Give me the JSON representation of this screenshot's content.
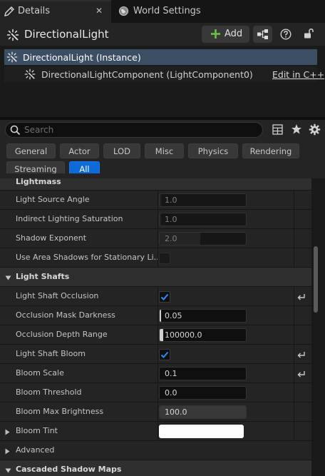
{
  "tabs": {
    "details": "Details",
    "close": "✕",
    "world_settings": "World Settings"
  },
  "header": {
    "title": "DirectionalLight",
    "add_label": "Add"
  },
  "tree": {
    "instance": "DirectionalLight (Instance)",
    "component": "DirectionalLightComponent (LightComponent0)",
    "edit_link": "Edit in C++"
  },
  "search": {
    "placeholder": "Search"
  },
  "filters": {
    "row1": [
      "General",
      "Actor",
      "LOD",
      "Misc",
      "Physics",
      "Rendering"
    ],
    "row2": [
      "Streaming",
      "All"
    ],
    "active": "All"
  },
  "properties": {
    "lightmass_header": "Lightmass",
    "light_source_angle": {
      "label": "Light Source Angle",
      "value": "1.0"
    },
    "indirect_saturation": {
      "label": "Indirect Lighting Saturation",
      "value": "1.0"
    },
    "shadow_exponent": {
      "label": "Shadow Exponent",
      "value": "2.0"
    },
    "use_area_shadows": {
      "label": "Use Area Shadows for Stationary Li..."
    },
    "light_shafts_header": "Light Shafts",
    "light_shaft_occlusion": {
      "label": "Light Shaft Occlusion",
      "checked": true
    },
    "occlusion_mask_darkness": {
      "label": "Occlusion Mask Darkness",
      "value": "0.05"
    },
    "occlusion_depth_range": {
      "label": "Occlusion Depth Range",
      "value": "100000.0"
    },
    "light_shaft_bloom": {
      "label": "Light Shaft Bloom",
      "checked": true
    },
    "bloom_scale": {
      "label": "Bloom Scale",
      "value": "0.1"
    },
    "bloom_threshold": {
      "label": "Bloom Threshold",
      "value": "0.0"
    },
    "bloom_max_brightness": {
      "label": "Bloom Max Brightness",
      "value": "100.0"
    },
    "bloom_tint": {
      "label": "Bloom Tint",
      "color": "#ffffff"
    },
    "advanced": {
      "label": "Advanced"
    },
    "cascaded_header": "Cascaded Shadow Maps"
  },
  "colors": {
    "accent": "#0e6ad9",
    "selection": "#3c4e63",
    "add_icon": "#6cc04a"
  }
}
